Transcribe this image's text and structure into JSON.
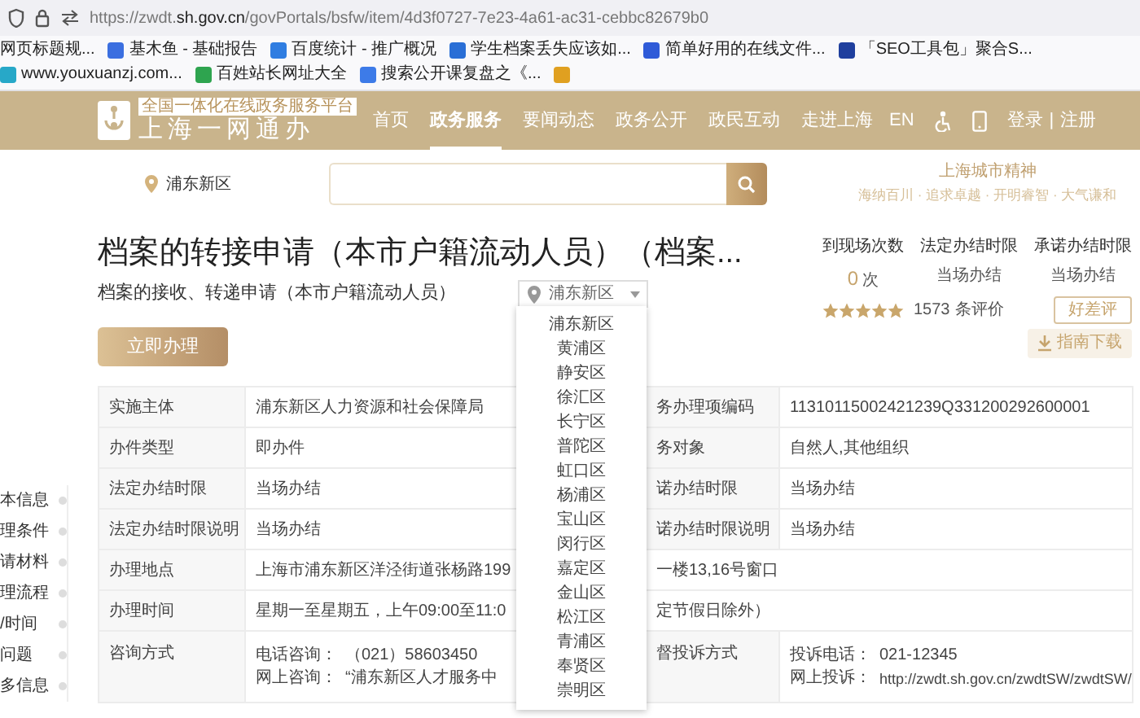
{
  "browser": {
    "url": "https://zwdt.**sh.gov.cn**/govPortals/bsfw/item/4d3f0727-7e23-4a61-ac31-cebbc82679b0"
  },
  "bookmarks": [
    {
      "label": "网页标题规..."
    },
    {
      "label": "基木鱼 - 基础报告",
      "color": "#3b6fe0"
    },
    {
      "label": "百度统计 - 推广概况",
      "color": "#2f7de1"
    },
    {
      "label": "学生档案丢失应该如...",
      "color": "#2a6fd6"
    },
    {
      "label": "简单好用的在线文件...",
      "color": "#2f5bd8"
    },
    {
      "label": "「SEO工具包」聚合S...",
      "color": "#1f3f9e"
    },
    {
      "label": "www.youxuanzj.com...",
      "color": "#27a8c8"
    },
    {
      "label": "百姓站长网址大全",
      "color": "#2ea44f"
    },
    {
      "label": "搜索公开课复盘之《...",
      "color": "#3d7be8"
    },
    {
      "color": "#e0a020"
    }
  ],
  "header": {
    "logo_tagline": "全国一体化在线政务服务平台",
    "logo_title": "上海一网通办",
    "nav": [
      {
        "label": "首页",
        "selected": false
      },
      {
        "label": "政务服务",
        "selected": true
      },
      {
        "label": "要闻动态",
        "selected": false
      },
      {
        "label": "政务公开",
        "selected": false
      },
      {
        "label": "政民互动",
        "selected": false
      },
      {
        "label": "走进上海",
        "selected": false
      }
    ],
    "lang": "EN",
    "login": "登录",
    "separator": "|",
    "register": "注册"
  },
  "search": {
    "location": "浦东新区"
  },
  "slogan": {
    "title": "上海城市精神",
    "subtitle": "海纳百川 · 追求卓越 · 开明睿智 · 大气谦和"
  },
  "item": {
    "title": "档案的转接申请（本市户籍流动人员）（档案...",
    "subtitle": "档案的接收、转递申请（本市户籍流动人员）",
    "district": "浦东新区",
    "apply_button": "立即办理"
  },
  "stats": [
    {
      "label": "到现场次数",
      "value": "0",
      "unit": "次"
    },
    {
      "label": "法定办结时限",
      "value": "当场办结"
    },
    {
      "label": "承诺办结时限",
      "value": "当场办结"
    }
  ],
  "rating": {
    "stars": 5,
    "count": "1573",
    "count_label": "条评价",
    "button": "好差评"
  },
  "download_button": "指南下载",
  "district_menu": [
    "浦东新区",
    "黄浦区",
    "静安区",
    "徐汇区",
    "长宁区",
    "普陀区",
    "虹口区",
    "杨浦区",
    "宝山区",
    "闵行区",
    "嘉定区",
    "金山区",
    "松江区",
    "青浦区",
    "奉贤区",
    "崇明区"
  ],
  "sidebar": [
    "本信息",
    "理条件",
    "请材料",
    "理流程",
    "/时间",
    "问题",
    "多信息"
  ],
  "table": {
    "rows": [
      {
        "kind": "pair",
        "label": "实施主体",
        "value": "浦东新区人力资源和社会保障局",
        "label_2": "务办理项编码",
        "value_2": "11310115002421239Q331200292600001"
      },
      {
        "kind": "pair",
        "label": "办件类型",
        "value": "即办件",
        "label_2": "务对象",
        "value_2": "自然人,其他组织"
      },
      {
        "kind": "pair",
        "label": "法定办结时限",
        "value": "当场办结",
        "label_2": "诺办结时限",
        "value_2": "当场办结"
      },
      {
        "kind": "pair",
        "label": "法定办结时限说明",
        "value": "当场办结",
        "label_2": "诺办结时限说明",
        "value_2": "当场办结"
      },
      {
        "kind": "wide",
        "label": "办理地点",
        "value": "上海市浦东新区洋泾街道张杨路199",
        "value_tail": "一楼13,16号窗口"
      },
      {
        "kind": "wide",
        "label": "办理时间",
        "value": "星期一至星期五，上午09:00至11:0",
        "value_tail": "定节假日除外）"
      },
      {
        "kind": "contact",
        "label": "咨询方式",
        "lines": [
          {
            "label": "电话咨询：",
            "value": "（021）58603450"
          },
          {
            "label": "网上咨询：",
            "value": "“浦东新区人才服务中"
          }
        ],
        "label_2": "督投诉方式",
        "lines_2": [
          {
            "label": "投诉电话：",
            "value": "021-12345"
          },
          {
            "label": "网上投诉：",
            "value": "http://zwdt.sh.gov.cn/zwdtSW/zwdtSW/"
          }
        ]
      }
    ]
  }
}
